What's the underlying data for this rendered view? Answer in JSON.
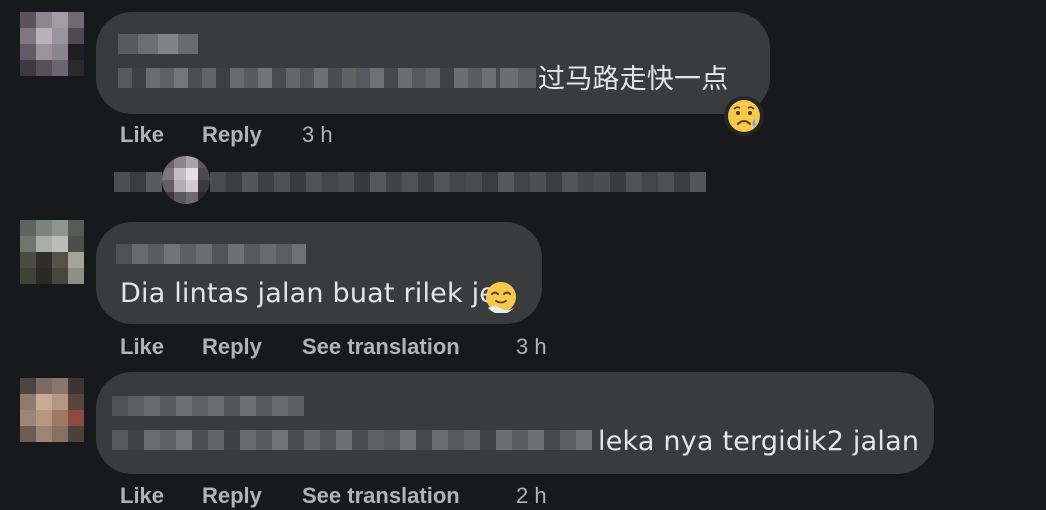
{
  "comments": [
    {
      "text": "过马路走快一点",
      "reaction_icon": "sad-relieved-face",
      "actions": {
        "like": "Like",
        "reply": "Reply",
        "time": "3 h"
      }
    },
    {
      "text": "Dia lintas jalan buat rilek je",
      "inline_emoji": "face-exhaling",
      "actions": {
        "like": "Like",
        "reply": "Reply",
        "translate": "See translation",
        "time": "3 h"
      }
    },
    {
      "text": "leka nya tergidik2 jalan",
      "actions": {
        "like": "Like",
        "reply": "Reply",
        "translate": "See translation",
        "time": "2 h"
      }
    }
  ],
  "colors": {
    "background": "#18191a",
    "bubble": "#3a3b3c",
    "action_text": "#b0b3b8",
    "comment_text": "#e4e6eb"
  }
}
